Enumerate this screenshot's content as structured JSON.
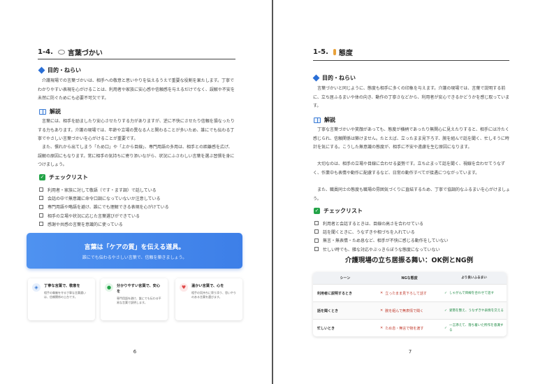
{
  "left": {
    "section_number": "1-4.",
    "section_title": "言葉づかい",
    "purpose_heading": "目的・ねらい",
    "purpose_text": "介護現場での言葉づかいは、相手への敬意と思いやりを伝えるうえで重要な役割を果たします。丁寧でわかりやすい表現を心がけることは、利用者や家族に安心感や信頼感を与えるだけでなく、誤解や不安を未然に防ぐためにも必要不可欠です。",
    "explain_heading": "解説",
    "explain_text_1": "言葉には、相手を励ましたり安心させたりする力がありますが、逆に不快にさせたり信頼を損なったりする力もあります。介護の現場では、年齢や立場の異なる人と関わることが多いため、誰にでも伝わる丁寧でやさしい言葉づかいを心がけることが重要です。",
    "explain_text_2": "また、慣れから出てしまう「ため口」や「上から目線」、専門用語の多用は、相手との距離感を広げ、誤解の原因にもなります。常に相手の気持ちに寄り添いながら、状況にふさわしい言葉を選ぶ習慣を身につけましょう。",
    "checklist_heading": "チェックリスト",
    "checklist": [
      "利用者・家族に対して敬語（です・ます調）で話している",
      "会話の中で無意識に命令口調になっていないか注意している",
      "専門用語や略語を避け、誰にでも理解できる表現を心がけている",
      "相手の立場や状況に応じた言葉選びができている",
      "感謝や共感の言葉を意識的に使っている"
    ],
    "banner_title": "言葉は「ケアの質」を伝える道具。",
    "banner_sub": "誰にでも伝わるやさしい言葉で、信頼を築きましょう。",
    "cards": [
      {
        "title": "丁寧な言葉で、敬意を",
        "desc": "相手の尊厳を守る丁寧な言葉遣いは、信頼関係の土台です。",
        "icon": "shield-icon",
        "color": "#3a7bd5"
      },
      {
        "title": "分かりやすい言葉で、安心を",
        "desc": "専門用語を避け、誰にでも伝わる平易な言葉で説明します。",
        "icon": "lightbulb-icon",
        "color": "#22a347"
      },
      {
        "title": "温かい言葉で、心を",
        "desc": "相手の気持ちに寄り添う、思いやりのある言葉を選びます。",
        "icon": "heart-icon",
        "color": "#e04848"
      }
    ],
    "page_number": "6"
  },
  "right": {
    "section_number": "1-5.",
    "section_title": "態度",
    "purpose_heading": "目的・ねらい",
    "purpose_text": "言葉づかいと同じように、態度も相手に多くの印象を与えます。介護の現場では、言葉で説明する前に、立ち居ふるまいや体の向き、動作の丁寧さなどから、利用者が安心できるかどうかを感じ取っています。",
    "explain_heading": "解説",
    "explain_text_1": "丁寧な言葉づかいや笑顔があっても、態度が横柄であったり無関心に見えたりすると、相手には冷たく感じられ、信頼関係は築けません。たとえば、立ったまま見下ろす、腕を組んで話を聞く、忙しそうに時計を気にする。こうした無意識の態度が、相手に不安や遠慮を生む原因になります。",
    "explain_text_2": "大切なのは、相手の立場や目線に合わせる姿勢です。立ち止まって話を聞く、視線を合わせてうなずく、作業中も表情や動作に配慮するなど、日常の動作すべてが接遇につながっています。",
    "explain_text_3": "また、職員同士の態度も職場の雰囲気づくりに直結するため、丁寧で協調的なふるまいを心がけましょう。",
    "checklist_heading": "チェックリスト",
    "checklist": [
      "利用者と会話するときは、目線の高さを合わせている",
      "話を聞くときに、うなずきや相づちを入れている",
      "無言・無表情・ため息など、相手が不快に感じる動作をしていない",
      "忙しい時でも、雑な対応やぶっきらぼうな態度になっていない"
    ],
    "table_title": "介護現場の立ち居振る舞い：OK例とNG例",
    "table_headers": [
      "シーン",
      "NGな態度",
      "より良いふるまい"
    ],
    "table_rows": [
      {
        "scene": "利用者に説明するとき",
        "ng": "立ったまま見下ろして話す",
        "ok": "しゃがんで目線を合わせて話す"
      },
      {
        "scene": "話を聞くとき",
        "ng": "腕を組んで無表情で聞く",
        "ok": "姿勢を整え、うなずきや表情を交える"
      },
      {
        "scene": "忙しいとき",
        "ng": "ため息・無言で物を渡す",
        "ok": "一言添えて、落ち着いた所作を意識する"
      }
    ],
    "page_number": "7"
  }
}
